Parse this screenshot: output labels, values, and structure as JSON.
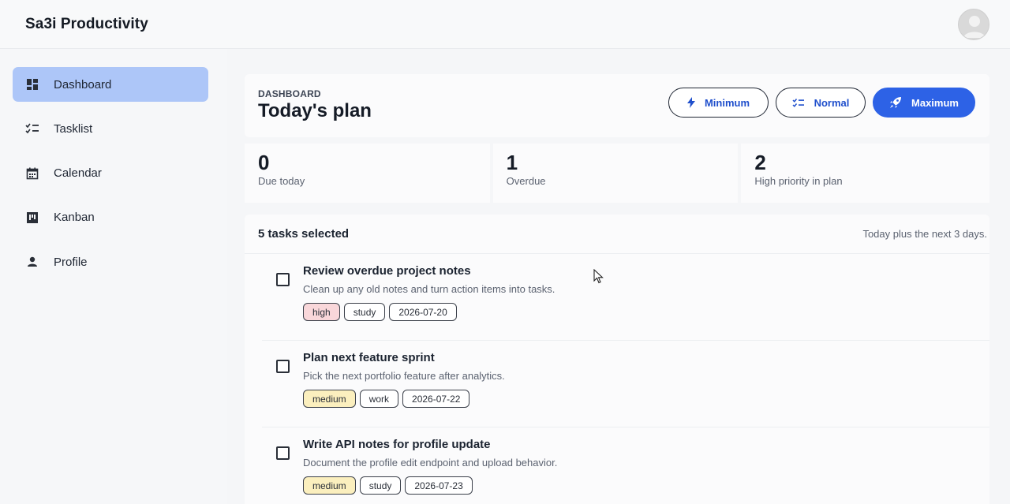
{
  "app": {
    "title": "Sa3i Productivity"
  },
  "sidebar": {
    "items": [
      {
        "label": "Dashboard",
        "icon": "dashboard-icon",
        "active": true
      },
      {
        "label": "Tasklist",
        "icon": "checklist-icon"
      },
      {
        "label": "Calendar",
        "icon": "calendar-icon"
      },
      {
        "label": "Kanban",
        "icon": "kanban-icon"
      },
      {
        "label": "Profile",
        "icon": "person-icon"
      }
    ]
  },
  "plan": {
    "eyebrow": "DASHBOARD",
    "title": "Today's plan",
    "modes": {
      "minimum": "Minimum",
      "normal": "Normal",
      "maximum": "Maximum"
    }
  },
  "stats": [
    {
      "value": "0",
      "label": "Due today"
    },
    {
      "value": "1",
      "label": "Overdue"
    },
    {
      "value": "2",
      "label": "High priority in plan"
    }
  ],
  "tasks": {
    "count_label": "5 tasks selected",
    "hint": "Today plus the next 3 days.",
    "items": [
      {
        "title": "Review overdue project notes",
        "desc": "Clean up any old notes and turn action items into tasks.",
        "priority": "high",
        "tag": "study",
        "date": "2026-07-20"
      },
      {
        "title": "Plan next feature sprint",
        "desc": "Pick the next portfolio feature after analytics.",
        "priority": "medium",
        "tag": "work",
        "date": "2026-07-22"
      },
      {
        "title": "Write API notes for profile update",
        "desc": "Document the profile edit endpoint and upload behavior.",
        "priority": "medium",
        "tag": "study",
        "date": "2026-07-23"
      }
    ]
  },
  "colors": {
    "accent": "#2d62e6",
    "active_nav": "#adc6f8",
    "high": "#f9d7da",
    "medium": "#fbefbe"
  }
}
